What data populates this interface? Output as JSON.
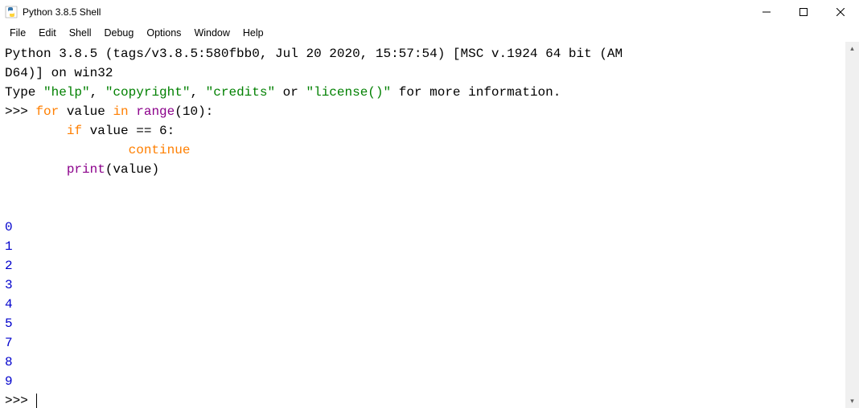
{
  "window": {
    "title": "Python 3.8.5 Shell"
  },
  "menubar": {
    "items": [
      "File",
      "Edit",
      "Shell",
      "Debug",
      "Options",
      "Window",
      "Help"
    ]
  },
  "banner": {
    "line1": "Python 3.8.5 (tags/v3.8.5:580fbb0, Jul 20 2020, 15:57:54) [MSC v.1924 64 bit (AM",
    "line2": "D64)] on win32",
    "line3_pre": "Type ",
    "line3_s1": "\"help\"",
    "line3_c1": ", ",
    "line3_s2": "\"copyright\"",
    "line3_c2": ", ",
    "line3_s3": "\"credits\"",
    "line3_c3": " or ",
    "line3_s4": "\"license()\"",
    "line3_post": " for more information."
  },
  "code": {
    "prompt": ">>> ",
    "l1_kw1": "for",
    "l1_mid": " value ",
    "l1_kw2": "in",
    "l1_sp": " ",
    "l1_fn": "range",
    "l1_tail": "(10):",
    "l2_indent": "        ",
    "l2_kw": "if",
    "l2_tail": " value == 6:",
    "l3_indent": "                ",
    "l3_kw": "continue",
    "l4_indent": "        ",
    "l4_fn": "print",
    "l4_tail": "(value)"
  },
  "output": {
    "lines": [
      "0",
      "1",
      "2",
      "3",
      "4",
      "5",
      "7",
      "8",
      "9"
    ]
  },
  "final_prompt": ">>> "
}
